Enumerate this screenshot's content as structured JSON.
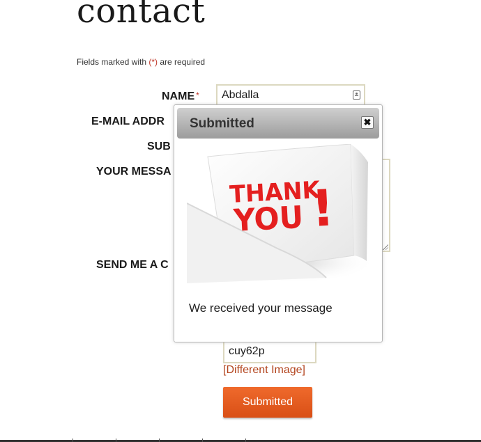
{
  "page": {
    "title": "contact",
    "required_note_prefix": "Fields marked with ",
    "required_note_marker": "(*)",
    "required_note_suffix": " are required"
  },
  "form": {
    "name_label": "NAME",
    "required_marker": "*",
    "name_value": "Abdalla",
    "email_label": "E-MAIL ADDR",
    "subject_label": "SUB",
    "message_label": "YOUR MESSA",
    "copy_label": "SEND ME A C",
    "captcha_value": "cuy62p",
    "different_image_link": "[Different Image]",
    "submit_label": "Submitted"
  },
  "modal": {
    "title": "Submitted",
    "close_glyph": "✖",
    "image_line1": "THANK",
    "image_line2": "YOU",
    "image_bang": "!",
    "message": "We received your message"
  },
  "colors": {
    "accent_orange": "#e05a1f",
    "required_red": "#c0392b",
    "link_rust": "#b3441d",
    "thank_you_red": "#e41f1f"
  }
}
